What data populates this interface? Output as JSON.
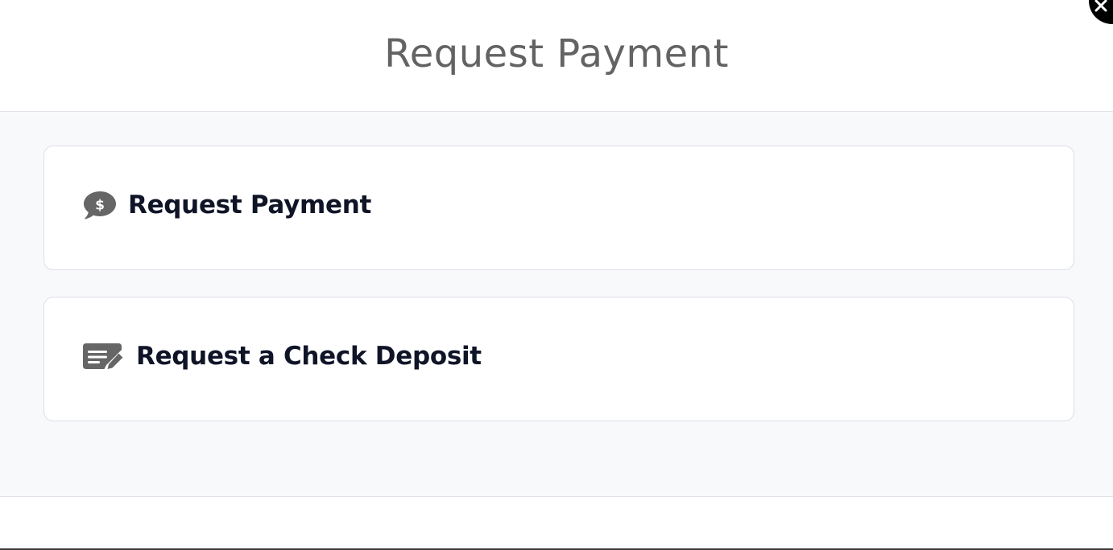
{
  "modal": {
    "title": "Request Payment"
  },
  "options": [
    {
      "label": "Request Payment",
      "icon": "dollar-chat-icon"
    },
    {
      "label": "Request a Check Deposit",
      "icon": "check-edit-icon"
    }
  ],
  "colors": {
    "title": "#636363",
    "label": "#0f1427",
    "icon": "#666666",
    "body_bg": "#f8f9fb",
    "border": "#dcdfe5"
  }
}
